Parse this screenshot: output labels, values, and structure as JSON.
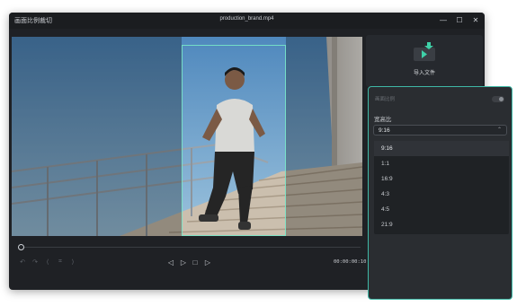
{
  "window": {
    "app_title": "画面比例裁切",
    "file_title": "production_brand.mp4",
    "controls": [
      "—",
      "☐",
      "✕"
    ]
  },
  "side_panel": {
    "import_label": "导入文件",
    "import_icon": "import-file-icon",
    "accent_color": "#3fd1a8"
  },
  "player": {
    "timecode": "00:00:00:10",
    "progress_fraction": 0.02,
    "tools": [
      "undo-icon",
      "redo-icon",
      "mark-in-icon",
      "crop-icon",
      "mark-out-icon"
    ],
    "transport": [
      "prev-frame-icon",
      "play-icon",
      "stop-icon",
      "next-frame-icon"
    ]
  },
  "ratio_popup": {
    "top_label": "画面比例",
    "ratio_label": "宽高比",
    "selected_value": "9:16",
    "options": [
      "9:16",
      "1:1",
      "16:9",
      "4:3",
      "4:5",
      "21:9"
    ],
    "selected_index": 0,
    "border_color": "#3fb8a6"
  }
}
